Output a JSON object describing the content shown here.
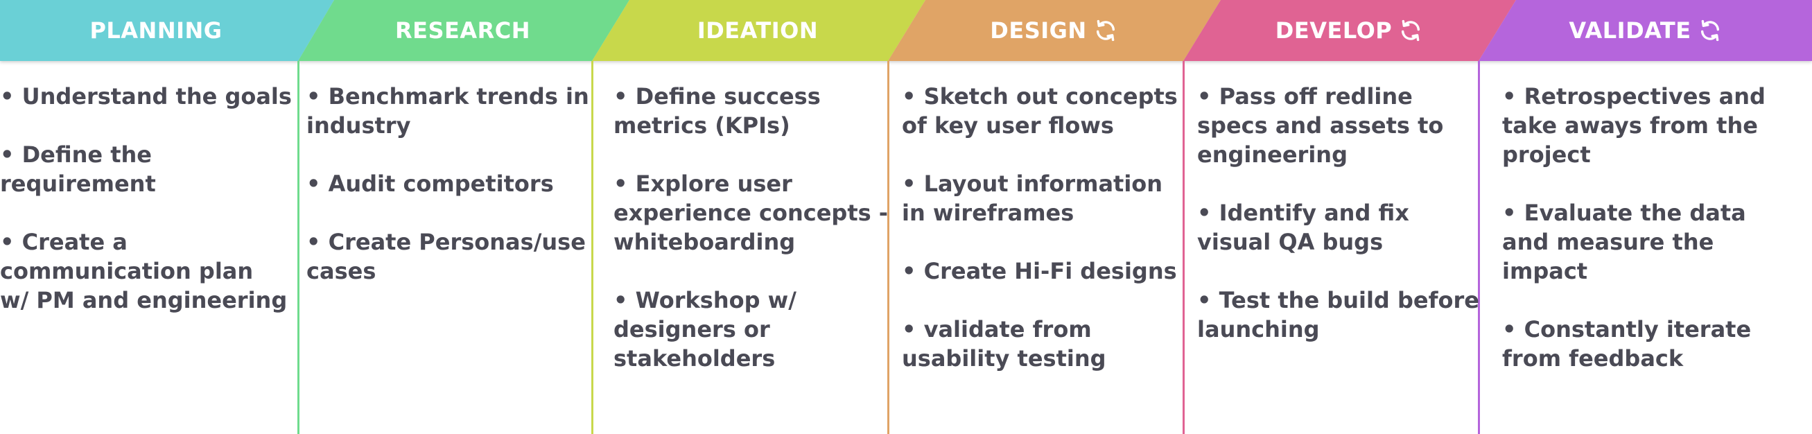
{
  "colors": {
    "planning": "#6ad0d6",
    "research": "#6fdb8d",
    "ideation": "#c8d84c",
    "design": "#e0a466",
    "develop": "#e06393",
    "validate": "#b565dc",
    "text": "#4a4a55",
    "header_text": "#ffffff"
  },
  "phases": [
    {
      "title": "PLANNING",
      "icon": null,
      "tasks": [
        [
          "• Understand the goals"
        ],
        [
          "• Define the",
          "requirement"
        ],
        [
          "• Create a",
          "communication plan",
          "w/ PM and engineering"
        ]
      ]
    },
    {
      "title": "RESEARCH",
      "icon": null,
      "tasks": [
        [
          "• Benchmark trends in",
          "industry"
        ],
        [
          "• Audit competitors"
        ],
        [
          "• Create Personas/use",
          "cases"
        ]
      ]
    },
    {
      "title": "IDEATION",
      "icon": null,
      "tasks": [
        [
          "• Define success",
          "metrics (KPIs)"
        ],
        [
          "• Explore user",
          "experience concepts -",
          "whiteboarding"
        ],
        [
          "• Workshop w/",
          "designers or",
          "stakeholders"
        ]
      ]
    },
    {
      "title": "DESIGN",
      "icon": "refresh-cycle-icon",
      "tasks": [
        [
          "• Sketch out concepts",
          "of key user flows"
        ],
        [
          "• Layout information",
          "in wireframes"
        ],
        [
          "• Create Hi-Fi designs"
        ],
        [
          "• validate from",
          "usability testing"
        ]
      ]
    },
    {
      "title": "DEVELOP",
      "icon": "refresh-cycle-icon",
      "tasks": [
        [
          "• Pass off redline",
          "specs and assets to",
          "engineering"
        ],
        [
          "• Identify and fix",
          "visual QA bugs"
        ],
        [
          "• Test the build before",
          "launching"
        ]
      ]
    },
    {
      "title": "VALIDATE",
      "icon": "refresh-cycle-icon",
      "tasks": [
        [
          "• Retrospectives and",
          "take aways from the",
          "project"
        ],
        [
          "• Evaluate the data",
          "and measure the",
          "impact"
        ],
        [
          "• Constantly iterate",
          "from feedback"
        ]
      ]
    }
  ]
}
